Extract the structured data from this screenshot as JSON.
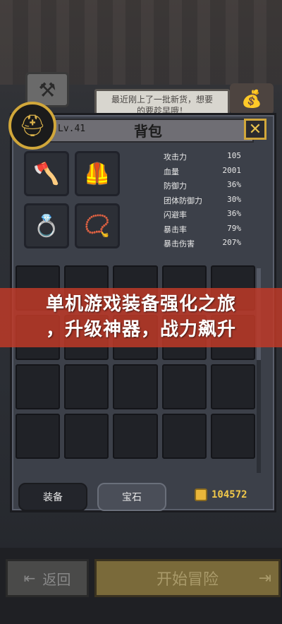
{
  "shop": {
    "speech_line1": "最近刚上了一批新货，想要",
    "speech_line2": "的要趁早哦！"
  },
  "inventory": {
    "level": "Lv.41",
    "title": "背包",
    "close_symbol": "✕",
    "equipment": [
      {
        "icon": "axe-icon",
        "glyph": "🪓"
      },
      {
        "icon": "armor-icon",
        "glyph": "🦺"
      },
      {
        "icon": "ring-icon",
        "glyph": "💍"
      },
      {
        "icon": "necklace-icon",
        "glyph": "📿"
      }
    ],
    "stats": [
      {
        "label": "攻击力",
        "value": "105"
      },
      {
        "label": "血量",
        "value": "2001"
      },
      {
        "label": "防御力",
        "value": "36%"
      },
      {
        "label": "团体防御力",
        "value": "30%"
      },
      {
        "label": "闪避率",
        "value": "36%"
      },
      {
        "label": "暴击率",
        "value": "79%"
      },
      {
        "label": "暴击伤害",
        "value": "207%"
      }
    ],
    "tabs": {
      "equip": "装备",
      "gem": "宝石"
    },
    "gold": "104572"
  },
  "banner": {
    "line1": "单机游戏装备强化之旅",
    "line2": "，升级神器，战力飙升"
  },
  "bottom": {
    "back_label": "返回",
    "start_label": "开始冒险"
  },
  "colors": {
    "accent_gold": "#d1a73a",
    "banner_red": "#be3a28",
    "panel": "#3c4049"
  }
}
